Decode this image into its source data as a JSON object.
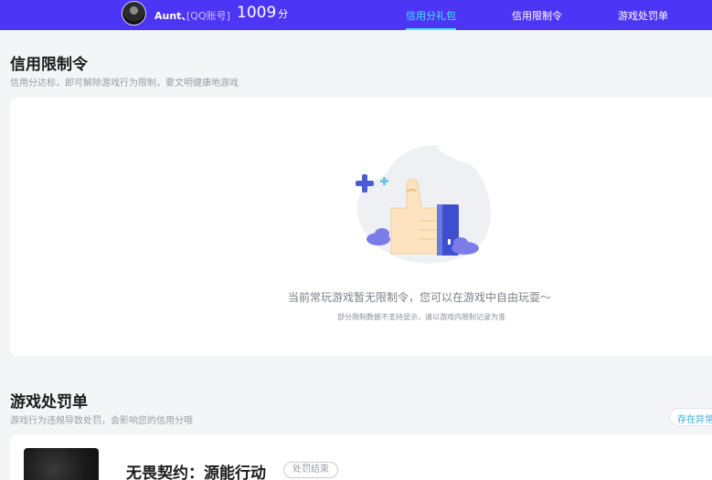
{
  "header": {
    "username": "Aunt、",
    "account_type": "[QQ账号]",
    "credit_score": "1009",
    "credit_unit": "分",
    "tabs": [
      {
        "label": "信用分礼包",
        "active": true
      },
      {
        "label": "信用限制令",
        "active": false
      },
      {
        "label": "游戏处罚单",
        "active": false
      }
    ]
  },
  "restriction": {
    "title": "信用限制令",
    "subtitle": "信用分达标，即可解除游戏行为限制，要文明健康地游戏",
    "empty_message": "当前常玩游戏暂无限制令，您可以在游戏中自由玩耍～",
    "empty_note": "部分限制数据不支持显示，请以游戏内限制记录为准"
  },
  "penalty": {
    "title": "游戏处罚单",
    "subtitle": "游戏行为违规导致处罚，会影响您的信用分哦",
    "store_button": "存在异常",
    "items": [
      {
        "game": "无畏契约：源能行动",
        "status": "处罚结束"
      }
    ]
  },
  "colors": {
    "brand": "#4d35f5",
    "active_tab": "#49e6ff",
    "background": "#f4f5f7"
  }
}
